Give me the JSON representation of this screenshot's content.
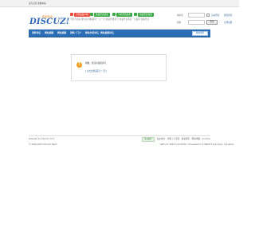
{
  "topbar": {
    "links": "设为首页  收藏本站"
  },
  "logo": {
    "main": "DISCUZ!",
    "top": "北京站点"
  },
  "quicklinks": [
    {
      "tag": "手机版客户端",
      "sub": "手机手机版 微信客户端",
      "color": "#e94c3d",
      "icon_color": "#e94c3d"
    },
    {
      "tag": "快速登录通道",
      "sub": "扫描同一 扫一扫 快速登录",
      "color": "#3aa745",
      "icon_color": "#3aa745"
    },
    {
      "tag": "手机登录通道",
      "sub": "手机号 快速登录通道",
      "color": "#3aa745",
      "icon_color": "#3aa745"
    },
    {
      "tag": "快速登录通道",
      "sub": "扫描同 快速登录",
      "color": "#3aa745",
      "icon_color": "#3aa745"
    }
  ],
  "login": {
    "user_label": "用户名",
    "forgot": "找回密码",
    "remember_label": "自动登录",
    "login_btn": "登录",
    "register": "立即注册"
  },
  "nav": {
    "items": [
      "资料论坛",
      "网站视频",
      "网站视频",
      "资料／门户",
      "网站作者论坛",
      "网站视频论坛"
    ],
    "search": "站内搜索"
  },
  "notice": {
    "message": "抱歉，您没有权限访问",
    "link": "[ 点击这里返回上一页 ]"
  },
  "footer": {
    "powered": "Powered by Discuz! X3.4",
    "copyright": "© 2001-2017 Discuz! Team.",
    "badge": "站长统计",
    "links": "站点统计 · 举报  |  小黑屋  ·  联系我们  ·  网站地图  ·  Archiver",
    "time": "GMT+8, 2024-3-12 08:10 , Processed in 0.066273 second(s), 4 queries ."
  }
}
